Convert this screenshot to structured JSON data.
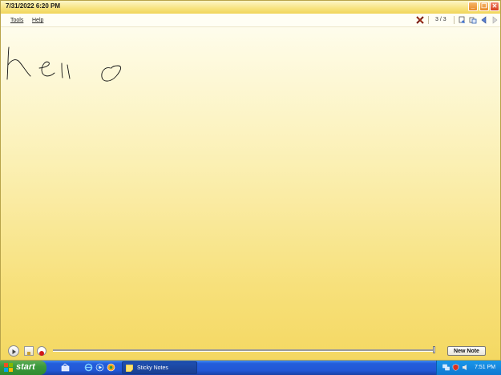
{
  "window": {
    "title": "7/31/2022 6:20 PM",
    "controls": {
      "minimize": "minimize-icon",
      "maximize": "maximize-icon",
      "close": "close-icon"
    }
  },
  "menu": {
    "tools": "Tools",
    "help": "Help"
  },
  "toolbar": {
    "counter": "3 / 3"
  },
  "note": {
    "ink_text": "hello",
    "ink_color": "#111111"
  },
  "playback": {
    "new_note_label": "New Note",
    "position": 1.0
  },
  "taskbar": {
    "start_label": "start",
    "task_label": "Sticky Notes",
    "clock": "7:51 PM"
  },
  "colors": {
    "note_top": "#fffffa",
    "note_bottom": "#f4d862",
    "taskbar": "#245edb",
    "start": "#3c9a3c"
  }
}
